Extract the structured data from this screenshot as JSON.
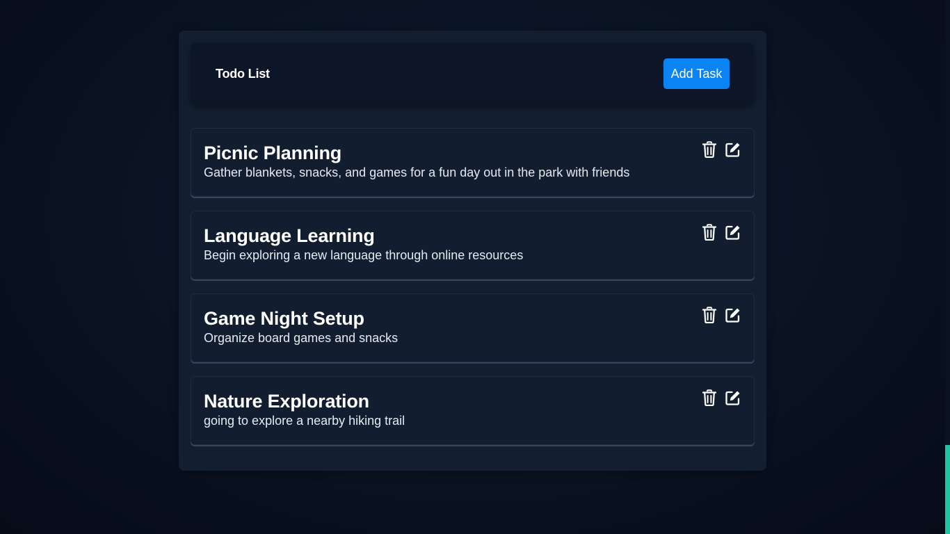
{
  "header": {
    "title": "Todo List",
    "add_label": "Add Task"
  },
  "colors": {
    "accent": "#0a84f5",
    "scrollbar": "#1ec5a0"
  },
  "tasks": [
    {
      "title": "Picnic Planning",
      "description": "Gather blankets, snacks, and games for a fun day out in the park with friends",
      "icons": [
        "trash-icon",
        "edit-icon"
      ]
    },
    {
      "title": "Language Learning",
      "description": "Begin exploring a new language through online resources",
      "icons": [
        "trash-icon",
        "edit-icon"
      ]
    },
    {
      "title": "Game Night Setup",
      "description": "Organize board games and snacks",
      "icons": [
        "trash-icon",
        "edit-icon"
      ]
    },
    {
      "title": "Nature Exploration",
      "description": "going to explore a nearby hiking trail",
      "icons": [
        "trash-icon",
        "edit-icon"
      ]
    }
  ]
}
